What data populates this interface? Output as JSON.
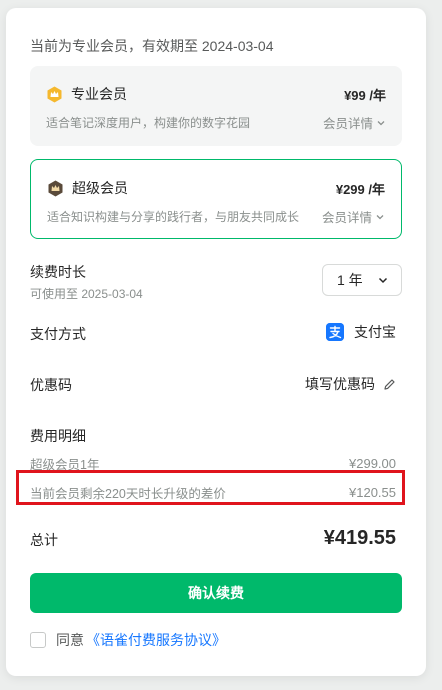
{
  "status_text": "当前为专业会员，有效期至 2024-03-04",
  "plans": [
    {
      "name": "专业会员",
      "price": "¥99 /年",
      "desc": "适合笔记深度用户，构建你的数字花园",
      "detail_label": "会员详情",
      "badge_color": "#f5b82e",
      "icon": "pro-crown-icon"
    },
    {
      "name": "超级会员",
      "price": "¥299 /年",
      "desc": "适合知识构建与分享的践行者，与朋友共同成长",
      "detail_label": "会员详情",
      "badge_color": "#5a4a3a",
      "icon": "super-crown-icon",
      "selected": true
    }
  ],
  "renewal": {
    "label": "续费时长",
    "valid_until": "可使用至 2025-03-04",
    "duration_value": "1 年"
  },
  "payment": {
    "label": "支付方式",
    "method": "支付宝",
    "icon": "alipay-icon"
  },
  "coupon": {
    "label": "优惠码",
    "action": "填写优惠码",
    "icon": "pencil-icon"
  },
  "fees": {
    "title": "费用明细",
    "items": [
      {
        "label": "超级会员1年",
        "amount": "¥299.00"
      },
      {
        "label": "当前会员剩余220天时长升级的差价",
        "amount": "¥120.55"
      }
    ]
  },
  "total": {
    "label": "总计",
    "amount": "¥419.55"
  },
  "confirm_button": "确认续费",
  "agreement": {
    "prefix": "同意",
    "link": "《语雀付费服务协议》"
  },
  "colors": {
    "accent": "#00b96b",
    "link": "#1677ff",
    "highlight": "#e0141c"
  }
}
